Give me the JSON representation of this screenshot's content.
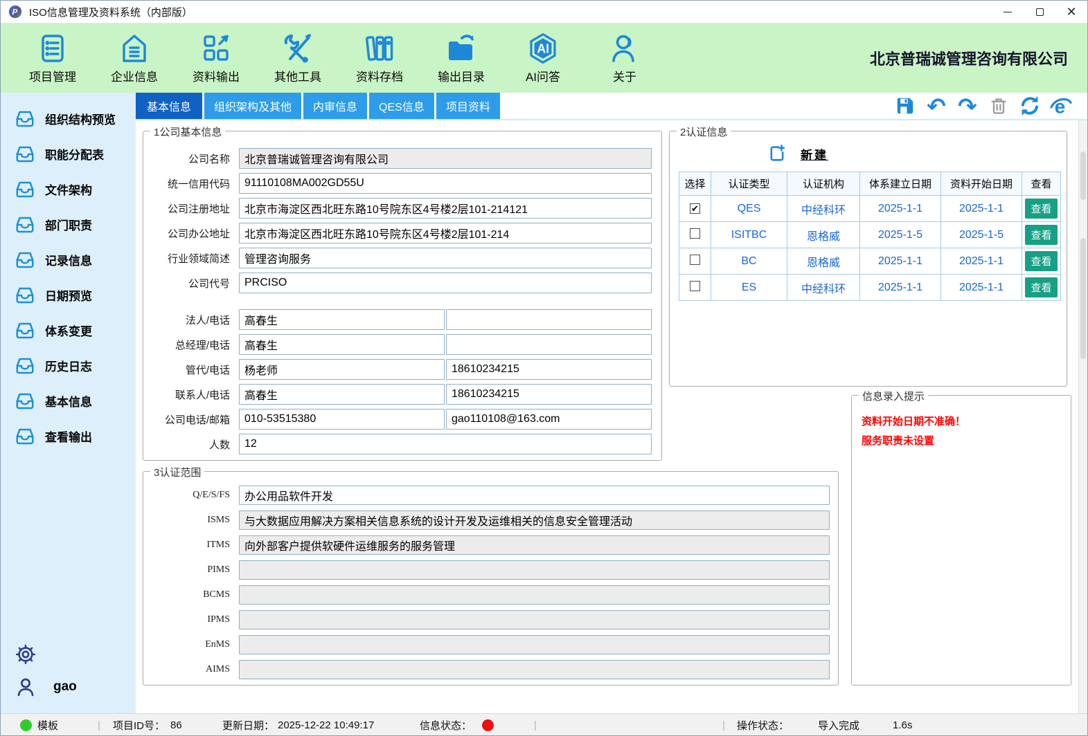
{
  "window": {
    "title": "ISO信息管理及资料系统（内部版）"
  },
  "icons": {
    "checked_glyph": "✔",
    "undo_glyph": "↶",
    "redo_glyph": "↷",
    "close_glyph": "✕"
  },
  "toolbar": {
    "items": [
      {
        "label": "项目管理"
      },
      {
        "label": "企业信息"
      },
      {
        "label": "资料输出"
      },
      {
        "label": "其他工具"
      },
      {
        "label": "资料存档"
      },
      {
        "label": "输出目录"
      },
      {
        "label": "AI问答"
      },
      {
        "label": "关于"
      }
    ],
    "company_name": "北京普瑞诚管理咨询有限公司"
  },
  "sidebar": {
    "items": [
      {
        "label": "组织结构预览"
      },
      {
        "label": "职能分配表"
      },
      {
        "label": "文件架构"
      },
      {
        "label": "部门职责"
      },
      {
        "label": "记录信息"
      },
      {
        "label": "日期预览"
      },
      {
        "label": "体系变更"
      },
      {
        "label": "历史日志"
      },
      {
        "label": "基本信息"
      },
      {
        "label": "查看输出"
      }
    ],
    "user": "gao"
  },
  "tabs": {
    "items": [
      {
        "label": "基本信息",
        "active": true
      },
      {
        "label": "组织架构及其他",
        "active": false
      },
      {
        "label": "内审信息",
        "active": false
      },
      {
        "label": "QES信息",
        "active": false
      },
      {
        "label": "项目资料",
        "active": false
      }
    ]
  },
  "company_form": {
    "title": "1公司基本信息",
    "rows": [
      {
        "label": "公司名称",
        "value": "北京普瑞诚管理咨询有限公司",
        "readonly": true
      },
      {
        "label": "统一信用代码",
        "value": "91110108MA002GD55U",
        "readonly": false
      },
      {
        "label": "公司注册地址",
        "value": "北京市海淀区西北旺东路10号院东区4号楼2层101-214121",
        "readonly": false
      },
      {
        "label": "公司办公地址",
        "value": "北京市海淀区西北旺东路10号院东区4号楼2层101-214",
        "readonly": false
      },
      {
        "label": "行业领域简述",
        "value": "管理咨询服务",
        "readonly": false
      },
      {
        "label": "公司代号",
        "value": "PRCISO",
        "readonly": false
      },
      {
        "label": "法人/电话",
        "value": "高春生",
        "value2": "",
        "readonly": false
      },
      {
        "label": "总经理/电话",
        "value": "高春生",
        "value2": "",
        "readonly": false
      },
      {
        "label": "管代/电话",
        "value": "杨老师",
        "value2": "18610234215",
        "readonly": false
      },
      {
        "label": "联系人/电话",
        "value": "高春生",
        "value2": "18610234215",
        "readonly": false
      },
      {
        "label": "公司电话/邮箱",
        "value": "010-53515380",
        "value2": "gao110108@163.com",
        "readonly": false
      },
      {
        "label": "人数",
        "value": "12",
        "readonly": false
      }
    ]
  },
  "cert": {
    "title": "2认证信息",
    "new_label": "新建",
    "columns": [
      "选择",
      "认证类型",
      "认证机构",
      "体系建立日期",
      "资料开始日期",
      "查看"
    ],
    "rows": [
      {
        "selected": true,
        "type": "QES",
        "agency": "中经科环",
        "sys_date": "2025-1-1",
        "data_date": "2025-1-1",
        "view_label": "查看"
      },
      {
        "selected": false,
        "type": "ISITBC",
        "agency": "恩格威",
        "sys_date": "2025-1-5",
        "data_date": "2025-1-5",
        "view_label": "查看"
      },
      {
        "selected": false,
        "type": "BC",
        "agency": "恩格威",
        "sys_date": "2025-1-1",
        "data_date": "2025-1-1",
        "view_label": "查看"
      },
      {
        "selected": false,
        "type": "ES",
        "agency": "中经科环",
        "sys_date": "2025-1-1",
        "data_date": "2025-1-1",
        "view_label": "查看"
      }
    ]
  },
  "scope": {
    "title": "3认证范围",
    "rows": [
      {
        "label": "Q/E/S/FS",
        "value": "办公用品软件开发",
        "readonly": false
      },
      {
        "label": "ISMS",
        "value": "与大数据应用解决方案相关信息系统的设计开发及运维相关的信息安全管理活动",
        "readonly": true
      },
      {
        "label": "ITMS",
        "value": "向外部客户提供软硬件运维服务的服务管理",
        "readonly": true
      },
      {
        "label": "PIMS",
        "value": "",
        "readonly": true
      },
      {
        "label": "BCMS",
        "value": "",
        "readonly": true
      },
      {
        "label": "IPMS",
        "value": "",
        "readonly": true
      },
      {
        "label": "EnMS",
        "value": "",
        "readonly": true
      },
      {
        "label": "AIMS",
        "value": "",
        "readonly": true
      }
    ]
  },
  "tips": {
    "title": "信息录入提示",
    "lines": [
      "资料开始日期不准确！",
      "服务职责未设置"
    ]
  },
  "statusbar": {
    "template_label": "模板",
    "project_id_label": "项目ID号：",
    "project_id": "86",
    "update_label": "更新日期：",
    "update_time": "2025-12-22 10:49:17",
    "info_status_label": "信息状态：",
    "op_status_label": "操作状态：",
    "op_status": "导入完成",
    "op_time": "1.6s"
  },
  "colors": {
    "accent_blue": "#1e88d8",
    "tab_active": "#1061c4",
    "tab_inactive": "#2d9cea",
    "toolbar_green": "#c9f4c5",
    "sidebar_blue": "#ddeffa",
    "view_button_teal": "#16a085",
    "alert_red": "#ff0000",
    "status_green": "#2ecc2e",
    "status_red": "#ee1111"
  }
}
